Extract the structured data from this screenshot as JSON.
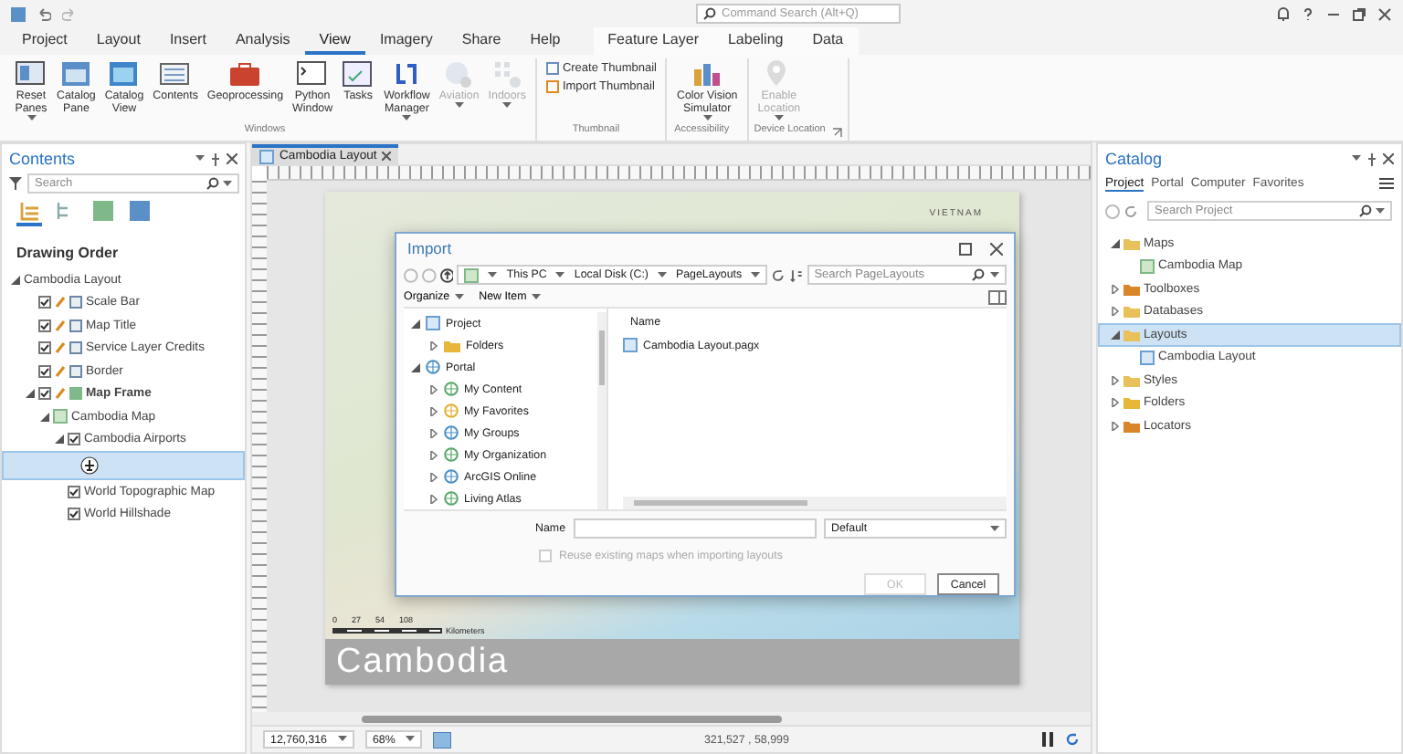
{
  "command_search": {
    "placeholder": "Command Search (Alt+Q)"
  },
  "tabs": [
    {
      "label": "Project",
      "selected": false
    },
    {
      "label": "Layout",
      "selected": false
    },
    {
      "label": "Insert",
      "selected": false
    },
    {
      "label": "Analysis",
      "selected": false
    },
    {
      "label": "View",
      "selected": true
    },
    {
      "label": "Imagery",
      "selected": false
    },
    {
      "label": "Share",
      "selected": false
    },
    {
      "label": "Help",
      "selected": false
    }
  ],
  "contextual_tabs": [
    {
      "label": "Feature Layer",
      "selected": false
    },
    {
      "label": "Labeling",
      "selected": false
    },
    {
      "label": "Data",
      "selected": false
    }
  ],
  "ribbon": [
    {
      "label": "Windows",
      "launcher": false,
      "buttons": [
        {
          "kind": "large",
          "label": "Reset\nPanes",
          "dropdown": true,
          "disabled": false
        },
        {
          "kind": "large",
          "label": "Catalog\nPane",
          "dropdown": false,
          "disabled": false
        },
        {
          "kind": "large",
          "label": "Catalog\nView",
          "dropdown": false,
          "disabled": false
        },
        {
          "kind": "large",
          "label": "Contents",
          "dropdown": false,
          "disabled": false
        },
        {
          "kind": "large",
          "label": "Geoprocessing",
          "dropdown": false,
          "disabled": false
        },
        {
          "kind": "large",
          "label": "Python\nWindow",
          "dropdown": false,
          "disabled": false
        },
        {
          "kind": "large",
          "label": "Tasks",
          "dropdown": false,
          "disabled": false
        },
        {
          "kind": "large",
          "label": "Workflow\nManager",
          "dropdown": true,
          "disabled": false
        },
        {
          "kind": "large",
          "label": "Aviation",
          "dropdown": true,
          "disabled": true
        },
        {
          "kind": "large",
          "label": "Indoors",
          "dropdown": true,
          "disabled": true
        }
      ]
    },
    {
      "label": "Thumbnail",
      "launcher": false,
      "buttons": [
        {
          "kind": "small",
          "label": "Create Thumbnail",
          "dropdown": false,
          "disabled": false
        },
        {
          "kind": "small",
          "label": "Import Thumbnail",
          "dropdown": false,
          "disabled": false
        }
      ]
    },
    {
      "label": "Accessibility",
      "launcher": false,
      "buttons": [
        {
          "kind": "large",
          "label": "Color Vision\nSimulator",
          "dropdown": true,
          "disabled": false
        }
      ]
    },
    {
      "label": "Device Location",
      "launcher": true,
      "buttons": [
        {
          "kind": "large",
          "label": "Enable\nLocation",
          "dropdown": true,
          "disabled": true
        }
      ]
    }
  ],
  "contents": {
    "title": "Contents",
    "search": {
      "placeholder": "Search"
    },
    "view_tabs": [
      {
        "selected": true
      },
      {
        "selected": false
      },
      {
        "selected": false
      },
      {
        "selected": false
      }
    ],
    "heading": "Drawing Order",
    "tree": [
      {
        "kind": "layout",
        "label": "Cambodia Layout",
        "expanded": true,
        "children": [
          {
            "kind": "element",
            "label": "Scale Bar",
            "checked": true
          },
          {
            "kind": "element",
            "label": "Map Title",
            "checked": true
          },
          {
            "kind": "element",
            "label": "Service Layer Credits",
            "checked": true
          },
          {
            "kind": "element",
            "label": "Border",
            "checked": true
          },
          {
            "kind": "map_frame",
            "label": "Map Frame",
            "checked": true,
            "expanded": true,
            "children": [
              {
                "kind": "map",
                "label": "Cambodia Map",
                "expanded": true,
                "children": [
                  {
                    "kind": "layer",
                    "label": "Cambodia Airports",
                    "checked": true,
                    "expanded": true,
                    "children": [
                      {
                        "kind": "symbol",
                        "selected": true
                      }
                    ]
                  },
                  {
                    "kind": "layer",
                    "label": "World Topographic Map",
                    "checked": true
                  },
                  {
                    "kind": "layer",
                    "label": "World Hillshade",
                    "checked": true
                  }
                ]
              }
            ]
          }
        ]
      }
    ]
  },
  "view": {
    "tab": {
      "label": "Cambodia Layout"
    },
    "layout": {
      "title": "Cambodia",
      "map_label": "VIETNAM",
      "scale_bar": {
        "ticks": [
          "0",
          "27",
          "54",
          "108"
        ],
        "unit": "Kilometers"
      }
    },
    "dialog": {
      "title": "Import",
      "path": [
        "This PC",
        "Local Disk (C:)",
        "PageLayouts"
      ],
      "search": {
        "placeholder": "Search PageLayouts"
      },
      "toolbar": [
        "Organize",
        "New Item"
      ],
      "tree": [
        {
          "label": "Project",
          "expanded": true,
          "children": [
            {
              "label": "Folders",
              "expanded": false
            }
          ]
        },
        {
          "label": "Portal",
          "expanded": true,
          "children": [
            {
              "label": "My Content",
              "expanded": false
            },
            {
              "label": "My Favorites",
              "expanded": false
            },
            {
              "label": "My Groups",
              "expanded": false
            },
            {
              "label": "My Organization",
              "expanded": false
            },
            {
              "label": "ArcGIS Online",
              "expanded": false
            },
            {
              "label": "Living Atlas",
              "expanded": false
            }
          ]
        }
      ],
      "column": "Name",
      "files": [
        "Cambodia Layout.pagx"
      ],
      "name_label": "Name",
      "filter": "Default",
      "reuse": {
        "label": "Reuse existing maps when importing layouts",
        "checked": false,
        "disabled": true
      },
      "buttons": [
        {
          "label": "OK",
          "disabled": true
        },
        {
          "label": "Cancel",
          "disabled": false
        }
      ]
    },
    "status": {
      "scale": "12,760,316",
      "zoom": "68%",
      "coordinates": "321,527 , 58,999"
    }
  },
  "catalog": {
    "title": "Catalog",
    "tabs": [
      {
        "label": "Project",
        "selected": true
      },
      {
        "label": "Portal",
        "selected": false
      },
      {
        "label": "Computer",
        "selected": false
      },
      {
        "label": "Favorites",
        "selected": false
      }
    ],
    "search": {
      "placeholder": "Search Project"
    },
    "tree": [
      {
        "label": "Maps",
        "expanded": true,
        "selected": false,
        "children": [
          {
            "kind": "map",
            "label": "Cambodia Map",
            "selected": false
          }
        ]
      },
      {
        "label": "Toolboxes",
        "expanded": false,
        "selected": false
      },
      {
        "label": "Databases",
        "expanded": false,
        "selected": false
      },
      {
        "label": "Layouts",
        "expanded": true,
        "selected": true,
        "children": [
          {
            "kind": "layout",
            "label": "Cambodia Layout",
            "selected": false
          }
        ]
      },
      {
        "label": "Styles",
        "expanded": false,
        "selected": false
      },
      {
        "label": "Folders",
        "expanded": false,
        "selected": false
      },
      {
        "label": "Locators",
        "expanded": false,
        "selected": false
      }
    ]
  }
}
